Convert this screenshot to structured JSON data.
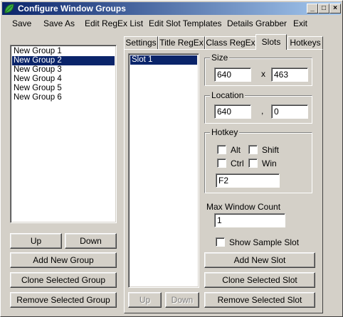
{
  "window": {
    "title": "Configure Window Groups"
  },
  "menu": [
    "Save",
    "Save As",
    "Edit RegEx List",
    "Edit Slot Templates",
    "Details Grabber",
    "Exit"
  ],
  "groups": {
    "items": [
      "New Group 1",
      "New Group 2",
      "New Group 3",
      "New Group 4",
      "New Group 5",
      "New Group 6"
    ],
    "selected_index": 1,
    "up_label": "Up",
    "down_label": "Down",
    "add_label": "Add New Group",
    "clone_label": "Clone Selected Group",
    "remove_label": "Remove Selected Group"
  },
  "tabs": [
    "Settings",
    "Title RegEx",
    "Class RegEx",
    "Slots",
    "Hotkeys"
  ],
  "active_tab": "Slots",
  "slots": {
    "items": [
      "Slot 1"
    ],
    "selected_index": 0,
    "up_label": "Up",
    "down_label": "Down"
  },
  "size": {
    "label": "Size",
    "width": "640",
    "separator": "x",
    "height": "463"
  },
  "location": {
    "label": "Location",
    "x": "640",
    "separator": ",",
    "y": "0"
  },
  "hotkey": {
    "label": "Hotkey",
    "alt_label": "Alt",
    "shift_label": "Shift",
    "ctrl_label": "Ctrl",
    "win_label": "Win",
    "alt_checked": false,
    "shift_checked": false,
    "ctrl_checked": false,
    "win_checked": false,
    "key": "F2"
  },
  "max_window_count": {
    "label": "Max Window Count",
    "value": "1"
  },
  "show_sample_slot": {
    "label": "Show Sample Slot",
    "checked": false
  },
  "slot_actions": {
    "add_label": "Add New Slot",
    "clone_label": "Clone Selected Slot",
    "remove_label": "Remove Selected Slot"
  },
  "title_buttons": {
    "minimize": "_",
    "maximize": "□",
    "close": "×"
  },
  "colors": {
    "titlebar_start": "#0a246a",
    "titlebar_end": "#a6caf0",
    "selection": "#0a246a",
    "face": "#d4d0c8"
  }
}
